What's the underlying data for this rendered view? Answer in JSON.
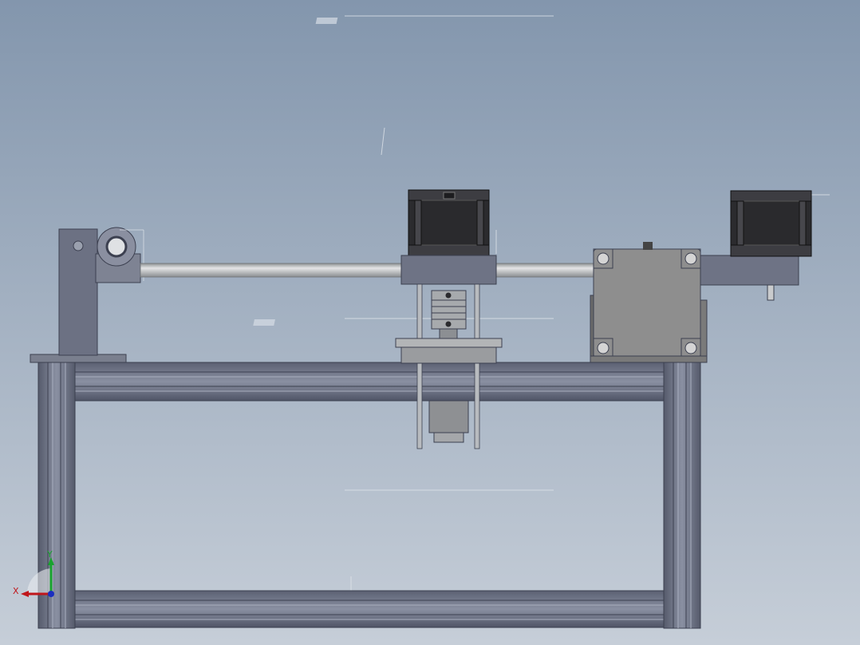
{
  "viewport": {
    "background_top": "#8396ad",
    "background_bottom": "#c6ced8"
  },
  "triad": {
    "x_label": "X",
    "y_label": "Y",
    "x_color": "#c0161b",
    "y_color": "#18a32e",
    "z_color": "#1b2ec0"
  },
  "model": {
    "frame_color": "#7b8192",
    "motor_body_color": "#2b2b2e",
    "shaft_color": "#c5c7c9",
    "gearbox_color": "#8e8e8e"
  }
}
